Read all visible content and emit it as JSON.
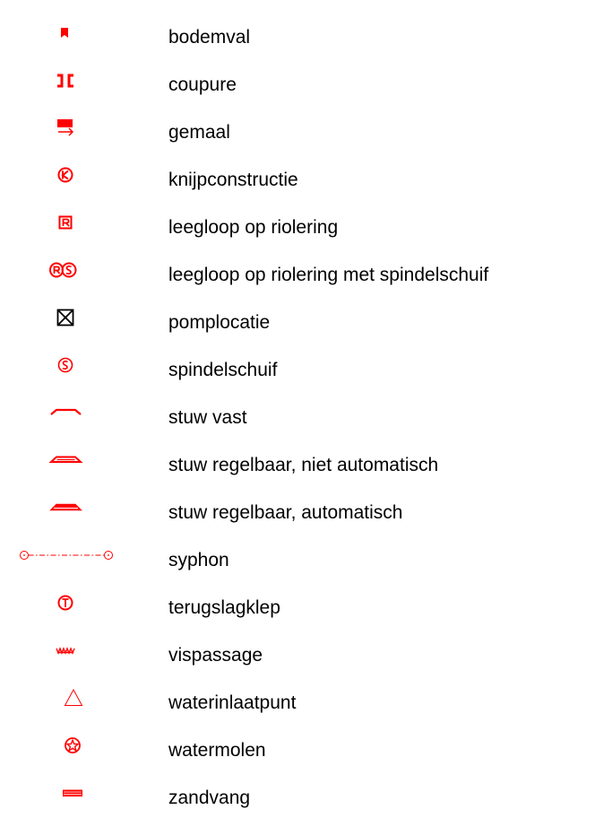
{
  "legend": {
    "symbol_color": "#ff0000",
    "items": [
      {
        "icon": "bodemval-icon",
        "label": "bodemval"
      },
      {
        "icon": "coupure-icon",
        "label": "coupure"
      },
      {
        "icon": "gemaal-icon",
        "label": "gemaal"
      },
      {
        "icon": "knijpconstructie-icon",
        "label": "knijpconstructie"
      },
      {
        "icon": "leegloop-riolering-icon",
        "label": "leegloop op riolering"
      },
      {
        "icon": "leegloop-riolering-spindelschuif-icon",
        "label": "leegloop op riolering met spindelschuif"
      },
      {
        "icon": "pomplocatie-icon",
        "label": "pomplocatie"
      },
      {
        "icon": "spindelschuif-icon",
        "label": "spindelschuif"
      },
      {
        "icon": "stuw-vast-icon",
        "label": "stuw vast"
      },
      {
        "icon": "stuw-regelbaar-niet-automatisch-icon",
        "label": "stuw regelbaar, niet automatisch"
      },
      {
        "icon": "stuw-regelbaar-automatisch-icon",
        "label": "stuw regelbaar, automatisch"
      },
      {
        "icon": "syphon-icon",
        "label": "syphon"
      },
      {
        "icon": "terugslagklep-icon",
        "label": "terugslagklep"
      },
      {
        "icon": "vispassage-icon",
        "label": "vispassage"
      },
      {
        "icon": "waterinlaatpunt-icon",
        "label": "waterinlaatpunt"
      },
      {
        "icon": "watermolen-icon",
        "label": "watermolen"
      },
      {
        "icon": "zandvang-icon",
        "label": "zandvang"
      }
    ]
  }
}
